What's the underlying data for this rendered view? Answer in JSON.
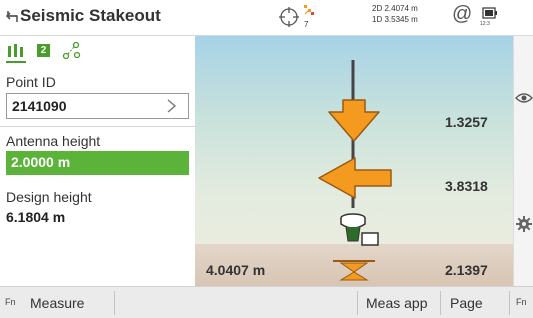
{
  "header": {
    "title": "Seismic Stakeout",
    "satellite_count": "7",
    "precision_2d": "2D 2.4074 m",
    "precision_1d": "1D 3.5345 m",
    "time": "12:3",
    "icons": [
      "back-icon",
      "target-icon",
      "satellite-icon",
      "at-icon",
      "battery-icon"
    ]
  },
  "left": {
    "active_tab": 0,
    "tab_badge": "2",
    "point_id_label": "Point ID",
    "point_id_value": "2141090",
    "antenna_height_label": "Antenna height",
    "antenna_height_value": "2.0000 m",
    "design_height_label": "Design height",
    "design_height_value": "6.1804 m"
  },
  "graphic": {
    "vertical_delta": "1.3257",
    "horizontal_delta": "3.8318",
    "bottom_left": "4.0407 m",
    "bottom_right": "2.1397"
  },
  "footer": {
    "fn_left": "Fn",
    "measure": "Measure",
    "meas_app": "Meas app",
    "page": "Page",
    "fn_right": "Fn"
  },
  "colors": {
    "accent_green": "#5cb33a",
    "arrow_orange": "#f39a1f",
    "sky_top": "#a6d3e6",
    "ground": "#d8c5b4"
  }
}
